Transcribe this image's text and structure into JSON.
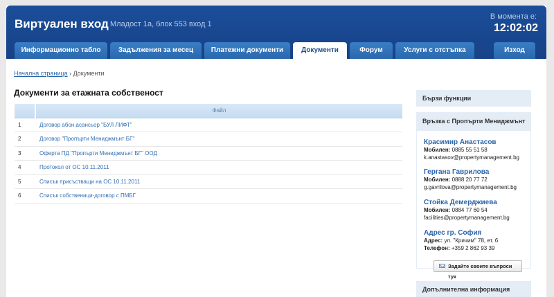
{
  "header": {
    "title": "Виртуален вход",
    "address": "Младост 1а, блок 553 вход 1",
    "clock_label": "В момента е:",
    "clock_time": "12:02:02"
  },
  "tabs": [
    {
      "label": "Информационно табло"
    },
    {
      "label": "Задължения за месец"
    },
    {
      "label": "Платежни документи"
    },
    {
      "label": "Документи"
    },
    {
      "label": "Форум"
    },
    {
      "label": "Услуги с отстъпка"
    },
    {
      "label": "Изход"
    }
  ],
  "breadcrumb": {
    "home": "Начална страница",
    "separator": "›",
    "current": "Документи"
  },
  "main": {
    "heading": "Документи за етажната собственост",
    "table": {
      "column_file": "Файл",
      "rows": [
        {
          "num": "1",
          "file": "Договор абон.асансьор \"БУЛ ЛИФТ\""
        },
        {
          "num": "2",
          "file": "Договор \"Пропърти Мениджмънт БГ\""
        },
        {
          "num": "3",
          "file": "Оферта ПД \"Пропърти Мениджмънт БГ\" ООД"
        },
        {
          "num": "4",
          "file": "Протокол от ОС 10.11.2011"
        },
        {
          "num": "5",
          "file": "Списък присъстващи на ОС 10.11.2011"
        },
        {
          "num": "6",
          "file": "Списък собственици-договор с ПМБГ"
        }
      ]
    }
  },
  "sidebar": {
    "quick_functions": "Бързи функции",
    "contact_title": "Връзка с Пропърти Мениджмънт",
    "contacts": [
      {
        "name": "Красимир Анастасов",
        "phone_label": "Мобилен:",
        "phone": "0885 55 51 58",
        "email": "k.anastasov@propertymanagement.bg"
      },
      {
        "name": "Гергана Гаврилова",
        "phone_label": "Мобилен:",
        "phone": "0888 20 77 72",
        "email": "g.gavrilova@propertymanagement.bg"
      },
      {
        "name": "Стойка Демерджиева",
        "phone_label": "Мобилен:",
        "phone": "0884 77 60 54",
        "email": "facilities@propertymanagement.bg"
      }
    ],
    "office": {
      "name": "Адрес гр. София",
      "address_label": "Адрес:",
      "address": "ул. \"Кричим\" 78, ет. 6",
      "phone_label": "Телефон:",
      "phone": "+359 2 862 93 39"
    },
    "ask_button": "Задайте своите въпроси тук",
    "more_info": "Допълнителна информация"
  }
}
